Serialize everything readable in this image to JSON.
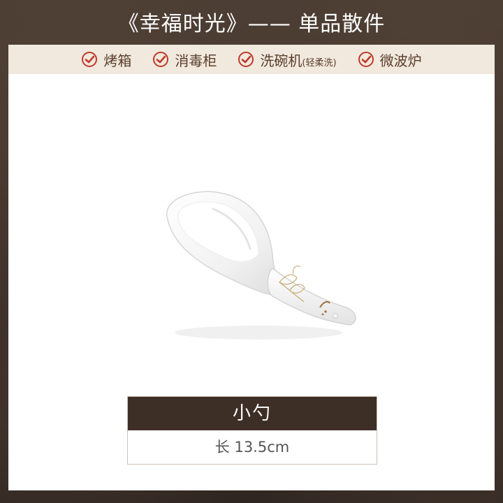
{
  "header": {
    "title": "《幸福时光》—— 单品散件"
  },
  "features": [
    {
      "icon": "check-circle-icon",
      "label": "烤箱",
      "sub": ""
    },
    {
      "icon": "check-circle-icon",
      "label": "消毒柜",
      "sub": ""
    },
    {
      "icon": "check-circle-icon",
      "label": "洗碗机",
      "sub": "(轻柔洗)"
    },
    {
      "icon": "check-circle-icon",
      "label": "微波炉",
      "sub": ""
    }
  ],
  "product": {
    "image": "porcelain-spoon-with-gold-ginkgo-pattern",
    "name": "小勺",
    "size": "长 13.5cm"
  },
  "colors": {
    "accent_red": "#c0392b",
    "feature_bar": "#f1e9dd",
    "caption_bar": "#3e2f26"
  }
}
